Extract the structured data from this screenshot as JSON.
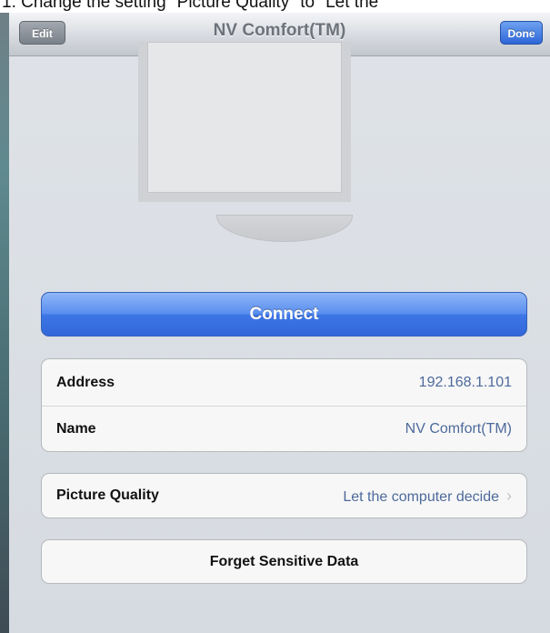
{
  "caption": "1.   Change the setting \"Picture Quality\" to \"Let the",
  "nav": {
    "title": "NV Comfort(TM)",
    "edit_label": "Edit",
    "done_label": "Done"
  },
  "connect_label": "Connect",
  "info": {
    "address_label": "Address",
    "address_value": "192.168.1.101",
    "name_label": "Name",
    "name_value": "NV Comfort(TM)"
  },
  "quality": {
    "label": "Picture Quality",
    "value": "Let the computer decide",
    "chevron": "›"
  },
  "forget_label": "Forget Sensitive Data",
  "colors": {
    "accent_blue": "#3d76e6",
    "value_text": "#4d6a9c"
  }
}
